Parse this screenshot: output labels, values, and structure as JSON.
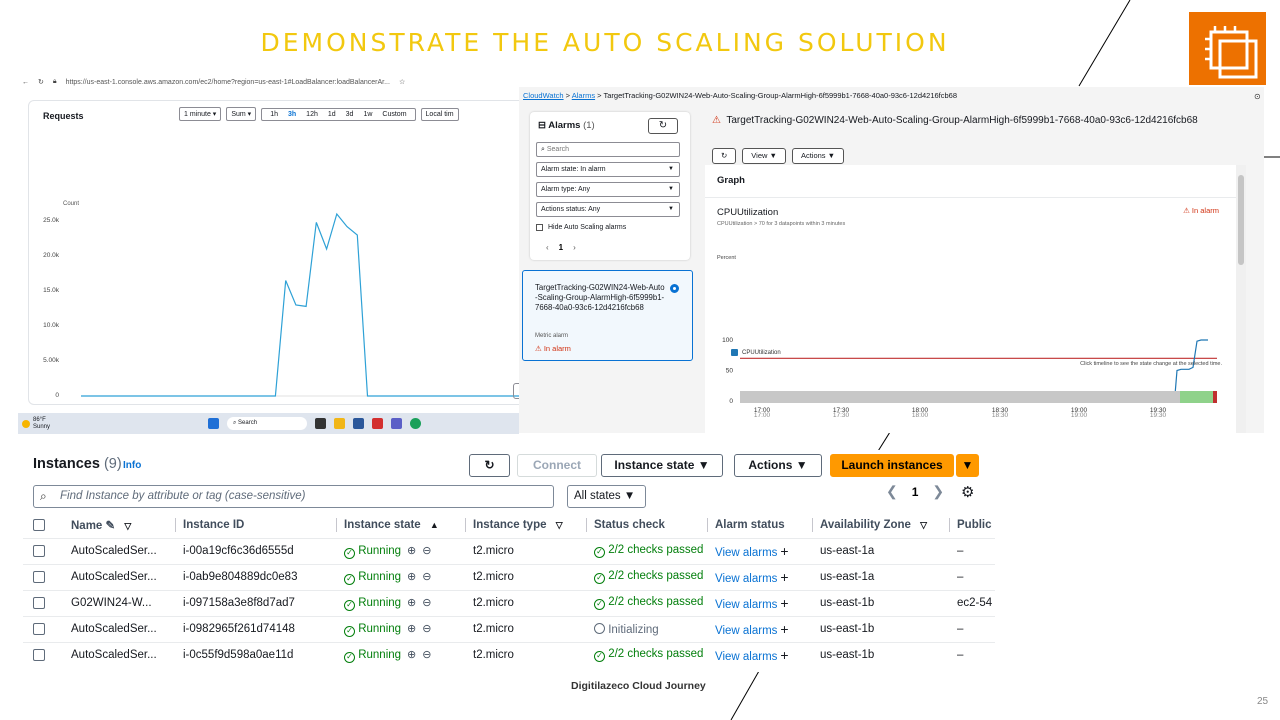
{
  "slide": {
    "title": "DEMONSTRATE THE AUTO SCALING SOLUTION",
    "footer": "Digitilazeco Cloud Journey",
    "page_number": "25"
  },
  "requests_view": {
    "url": "https://us-east-1.console.aws.amazon.com/ec2/home?region=us-east-1#LoadBalancer:loadBalancerAr...",
    "panel_title": "Requests",
    "period_select": "1 minute",
    "stat_select": "Sum",
    "ranges": [
      "1h",
      "3h",
      "12h",
      "1d",
      "3d",
      "1w",
      "Custom"
    ],
    "active_range": "3h",
    "timezone": "Local tim",
    "y_label": "Count",
    "y_ticks": [
      "25.0k",
      "20.0k",
      "15.0k",
      "10.0k",
      "5.00k",
      "0"
    ],
    "partial_button": "V",
    "series": [
      0,
      0,
      0,
      0,
      0,
      0,
      0,
      0,
      0,
      0,
      0,
      0,
      0,
      0,
      0,
      0,
      0,
      0,
      0,
      0,
      16500,
      13000,
      12800,
      24800,
      21000,
      26000,
      24200,
      23000,
      0,
      0,
      0,
      0,
      0,
      0,
      0,
      0,
      0,
      0,
      0,
      0,
      0,
      0,
      0,
      0
    ]
  },
  "taskbar": {
    "weather_temp": "86°F",
    "weather_desc": "Sunny",
    "search_placeholder": "Search"
  },
  "cloudwatch": {
    "breadcrumb": [
      "CloudWatch",
      "Alarms",
      "TargetTracking-G02WIN24-Web-Auto-Scaling-Group-AlarmHigh-6f5999b1-7668-40a0-93c6-12d4216fcb68"
    ],
    "alarms_heading": "Alarms",
    "alarms_count": "(1)",
    "search_placeholder": "Search",
    "filter_state": "Alarm state: In alarm",
    "filter_type": "Alarm type: Any",
    "filter_actions": "Actions status: Any",
    "hide_asg": "Hide Auto Scaling alarms",
    "page": "1",
    "card_name": "TargetTracking-G02WIN24-Web-Auto-Scaling-Group-AlarmHigh-6f5999b1-7668-40a0-93c6-12d4216fcb68",
    "card_type": "Metric alarm",
    "card_state": "In alarm",
    "alarm_title": "TargetTracking-G02WIN24-Web-Auto-Scaling-Group-AlarmHigh-6f5999b1-7668-40a0-93c6-12d4216fcb68",
    "view_btn": "View",
    "actions_btn": "Actions",
    "graph_heading": "Graph",
    "metric_title": "CPUUtilization",
    "metric_condition": "CPUUtilization > 70 for 3 datapoints within 3 minutes",
    "metric_state": "In alarm",
    "unit": "Percent",
    "y_ticks": [
      "100",
      "50",
      "0"
    ],
    "x_ticks": [
      "17:00",
      "17:30",
      "18:00",
      "18:30",
      "19:00",
      "19:30"
    ],
    "legend": "CPUUtilization",
    "hint": "Click timeline to see the state change at the selected time.",
    "threshold": 70
  },
  "instances": {
    "title": "Instances",
    "count": "(9)",
    "info": "Info",
    "connect": "Connect",
    "instance_state_btn": "Instance state",
    "actions_btn": "Actions",
    "launch_btn": "Launch instances",
    "search_placeholder": "Find Instance by attribute or tag (case-sensitive)",
    "states_filter": "All states",
    "page": "1",
    "columns": [
      "Name",
      "Instance ID",
      "Instance state",
      "Instance type",
      "Status check",
      "Alarm status",
      "Availability Zone",
      "Public"
    ],
    "rows": [
      {
        "name": "AutoScaledSer...",
        "id": "i-00a19cf6c36d6555d",
        "state": "Running",
        "type": "t2.micro",
        "check": "2/2 checks passed",
        "alarm": "View alarms",
        "az": "us-east-1a",
        "public": "–"
      },
      {
        "name": "AutoScaledSer...",
        "id": "i-0ab9e804889dc0e83",
        "state": "Running",
        "type": "t2.micro",
        "check": "2/2 checks passed",
        "alarm": "View alarms",
        "az": "us-east-1a",
        "public": "–"
      },
      {
        "name": "G02WIN24-W...",
        "id": "i-097158a3e8f8d7ad7",
        "state": "Running",
        "type": "t2.micro",
        "check": "2/2 checks passed",
        "alarm": "View alarms",
        "az": "us-east-1b",
        "public": "ec2-54"
      },
      {
        "name": "AutoScaledSer...",
        "id": "i-0982965f261d74148",
        "state": "Running",
        "type": "t2.micro",
        "check": "Initializing",
        "alarm": "View alarms",
        "az": "us-east-1b",
        "public": "–"
      },
      {
        "name": "AutoScaledSer...",
        "id": "i-0c55f9d598a0ae11d",
        "state": "Running",
        "type": "t2.micro",
        "check": "2/2 checks passed",
        "alarm": "View alarms",
        "az": "us-east-1b",
        "public": "–"
      }
    ]
  }
}
